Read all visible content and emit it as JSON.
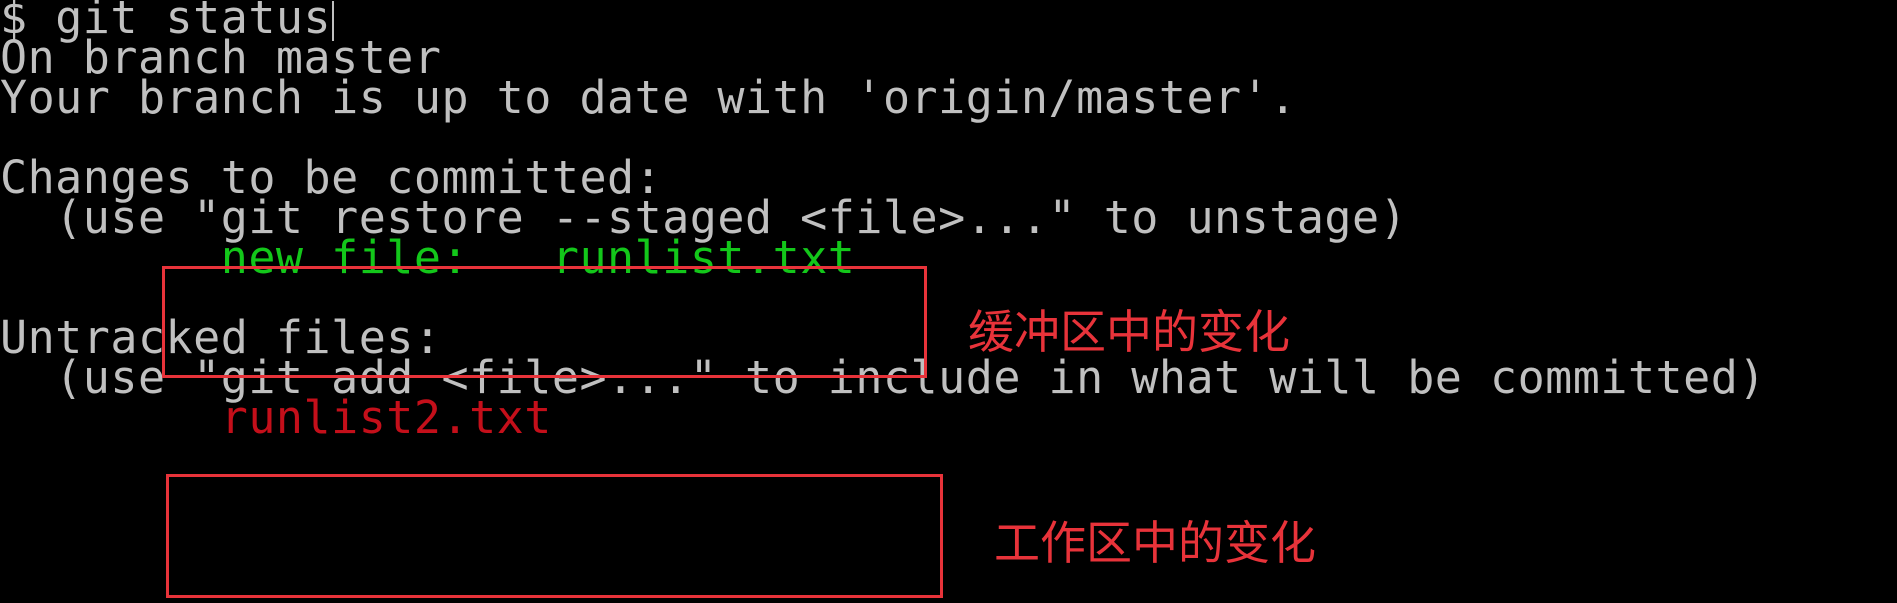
{
  "terminal": {
    "prompt": "$ ",
    "command": "git status",
    "branch_line": "On branch master",
    "up_to_date_line": "Your branch is up to date with 'origin/master'.",
    "staged_header": "Changes to be committed:",
    "staged_hint": "  (use \"git restore --staged <file>...\" to unstage)",
    "staged_indent": "        ",
    "staged_status": "new file:",
    "staged_spacer": "   ",
    "staged_file": "runlist.txt",
    "untracked_header": "Untracked files:",
    "untracked_hint": "  (use \"git add <file>...\" to include in what will be committed)",
    "untracked_indent": "        ",
    "untracked_file": "runlist2.txt"
  },
  "annotations": {
    "staged_label": "缓冲区中的变化",
    "untracked_label": "工作区中的变化"
  },
  "colors": {
    "background": "#000000",
    "default_text": "#c0c0c0",
    "staged_text": "#13c71a",
    "untracked_text": "#c40f1a",
    "annotation": "#e8333a"
  }
}
